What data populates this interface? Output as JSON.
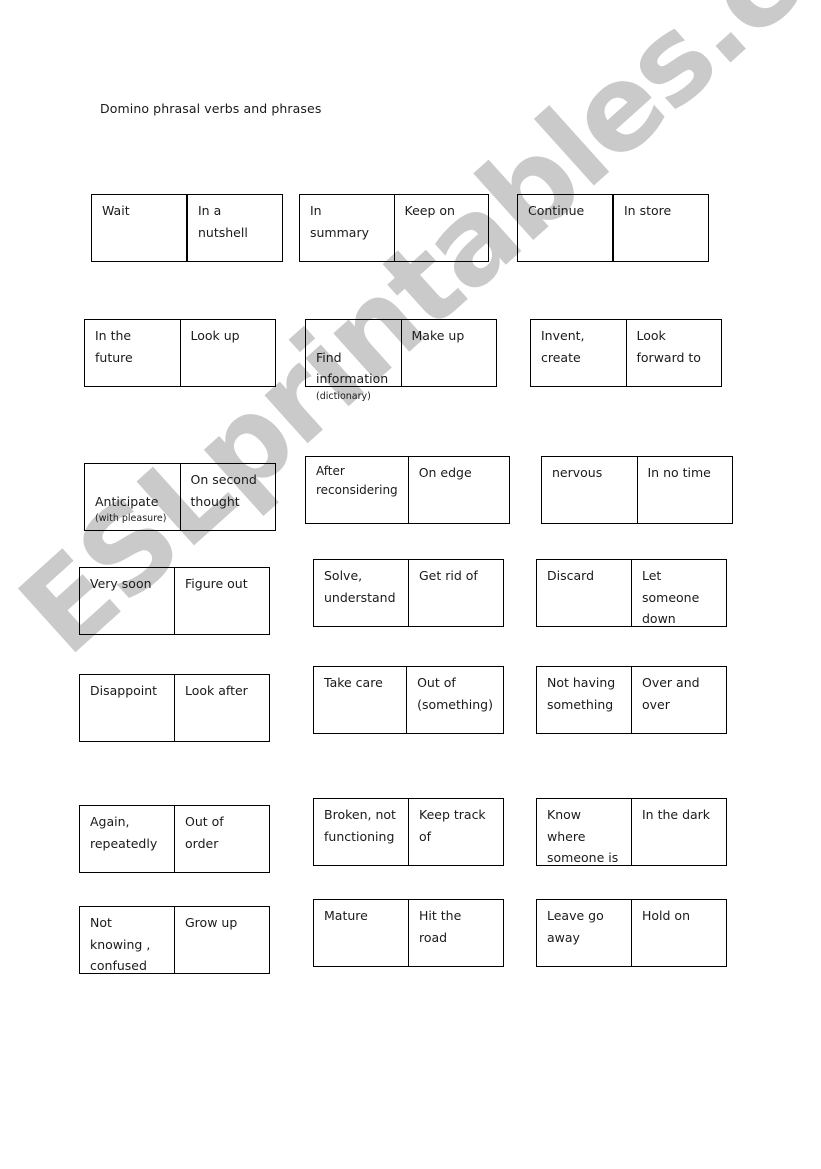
{
  "document": {
    "title": "Domino phrasal verbs and phrases",
    "watermark": "ESLprintables.com",
    "cards": [
      {
        "left": "Wait",
        "right": "In a\nnutshell"
      },
      {
        "left": "In summary",
        "right": "Keep on"
      },
      {
        "left": "Continue",
        "right": "In store"
      },
      {
        "left": "In the\nfuture",
        "right": "Look up"
      },
      {
        "left": "Find\ninformation",
        "left_note": "(dictionary)",
        "right": "Make up"
      },
      {
        "left": "Invent,\ncreate",
        "right": "Look\nforward to"
      },
      {
        "left": "Anticipate",
        "left_note": "(with pleasure)",
        "right": "On second\nthought"
      },
      {
        "left": "After\nreconsidering",
        "right": "On edge"
      },
      {
        "left": "nervous",
        "right": "In no time"
      },
      {
        "left": "Very soon",
        "right": "Figure out"
      },
      {
        "left": "Solve,\nunderstand",
        "right": "Get rid of"
      },
      {
        "left": "Discard",
        "right": "Let\nsomeone\ndown"
      },
      {
        "left": "Disappoint",
        "right": "Look after"
      },
      {
        "left": "Take care",
        "right": "Out of\n(something)"
      },
      {
        "left": "Not having\nsomething",
        "right": "Over and\nover"
      },
      {
        "left": "Again,\nrepeatedly",
        "right": "Out of\norder"
      },
      {
        "left": "Broken, not\nfunctioning",
        "right": "Keep track\nof"
      },
      {
        "left": "Know\nwhere\nsomeone is",
        "right": "In the dark"
      },
      {
        "left": "Not\nknowing ,\nconfused",
        "right": "Grow up"
      },
      {
        "left": "Mature",
        "right": "Hit the\nroad"
      },
      {
        "left": "Leave go\naway",
        "right": "Hold on"
      }
    ]
  }
}
